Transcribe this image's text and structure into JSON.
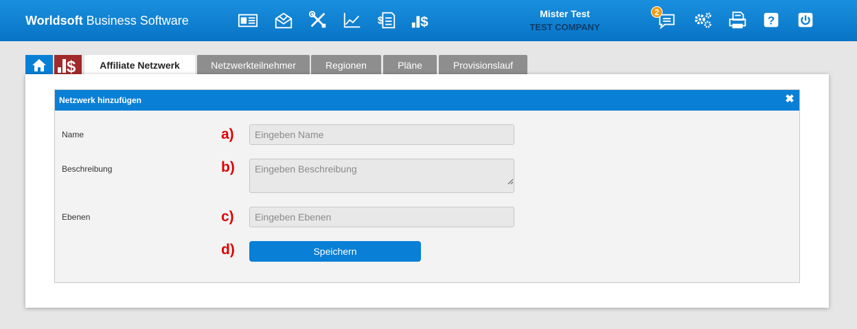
{
  "header": {
    "brand_bold": "Worldsoft",
    "brand_rest": " Business Software",
    "nav_icons": [
      "contact-card-icon",
      "mail-icon",
      "tools-icon",
      "chart-line-icon",
      "invoice-dollar-icon",
      "affiliate-dollar-icon"
    ],
    "user_name": "Mister Test",
    "company": "TEST COMPANY",
    "notification_count": "2",
    "right_icons": [
      "chat-icon",
      "settings-gears-icon",
      "print-icon",
      "help-icon",
      "power-icon"
    ]
  },
  "tabs": [
    {
      "label": "Affiliate Netzwerk",
      "active": true
    },
    {
      "label": "Netzwerkteilnehmer",
      "active": false
    },
    {
      "label": "Regionen",
      "active": false
    },
    {
      "label": "Pläne",
      "active": false
    },
    {
      "label": "Provisionslauf",
      "active": false
    }
  ],
  "dialog": {
    "title": "Netzwerk hinzufügen",
    "fields": [
      {
        "label": "Name",
        "marker": "a)",
        "placeholder": "Eingeben Name"
      },
      {
        "label": "Beschreibung",
        "marker": "b)",
        "placeholder": "Eingeben Beschreibung"
      },
      {
        "label": "Ebenen",
        "marker": "c)",
        "placeholder": "Eingeben Ebenen"
      }
    ],
    "save_marker": "d)",
    "save_label": "Speichern"
  },
  "colors": {
    "header_blue": "#0a7fd6",
    "logo_red": "#a12a2a",
    "marker_red": "#e00000",
    "tab_gray": "#8e8e8e"
  }
}
